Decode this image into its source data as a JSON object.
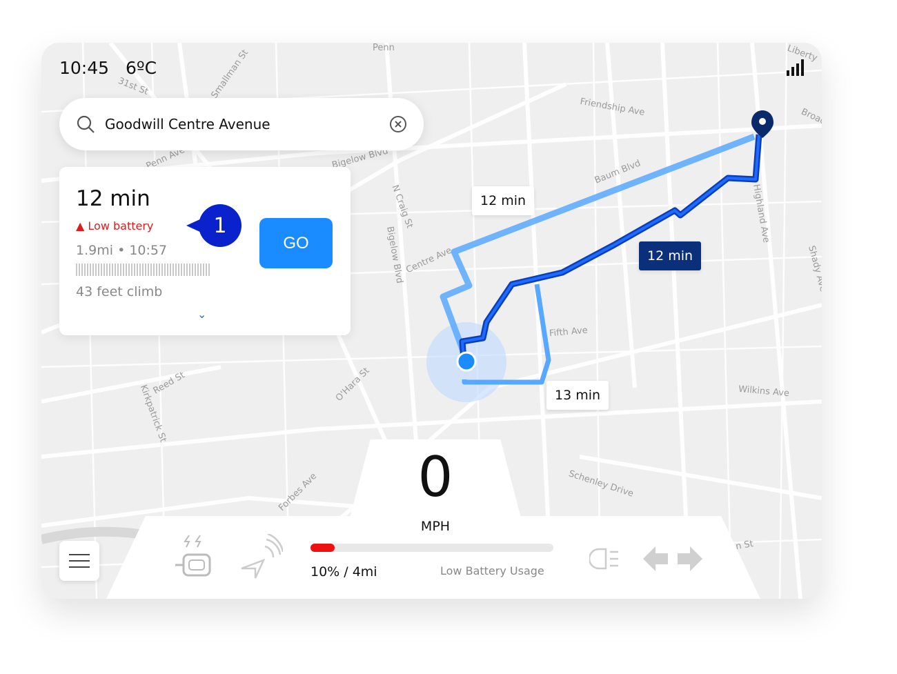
{
  "status": {
    "time": "10:45",
    "temperature": "6ºC",
    "signal_icon": "signal-bars-icon"
  },
  "search": {
    "value": "Goodwill Centre Avenue",
    "search_icon": "search-icon",
    "clear_icon": "clear-icon"
  },
  "route_card": {
    "duration": "12 min",
    "warning": "Low battery",
    "distance": "1.9mi",
    "separator": "•",
    "arrival": "10:57",
    "climb": "43 feet climb",
    "go_label": "GO",
    "annotation": "1"
  },
  "map": {
    "route_labels": {
      "alt_top": "12 min",
      "selected": "12 min",
      "alt_bottom": "13 min"
    },
    "streets": [
      "Penn",
      "31st St",
      "Smallman St",
      "Friendship Ave",
      "Liberty",
      "Baum Blvd",
      "Bigelow Blvd",
      "N Craig St",
      "Centre Ave",
      "Fifth Ave",
      "Reed St",
      "Kirkpatrick St",
      "O'Hara St",
      "Forbes Ave",
      "Schenley Drive",
      "Wilkins Ave",
      "Shady Ave",
      "Highland Ave",
      "Penn Ave",
      "Bigelow Blvd",
      "On St",
      "Broad"
    ],
    "colors": {
      "selected": "#0a3fb8",
      "alt": "#58a8ff",
      "destination": "#0b2a6b",
      "tag_selected": "#0b2f7a"
    }
  },
  "dashboard": {
    "speed": "0",
    "unit": "MPH",
    "battery_percent": 10,
    "battery_text": "10% / 4mi",
    "mode": "Low Battery Usage",
    "battery_color": "#ee1111"
  }
}
